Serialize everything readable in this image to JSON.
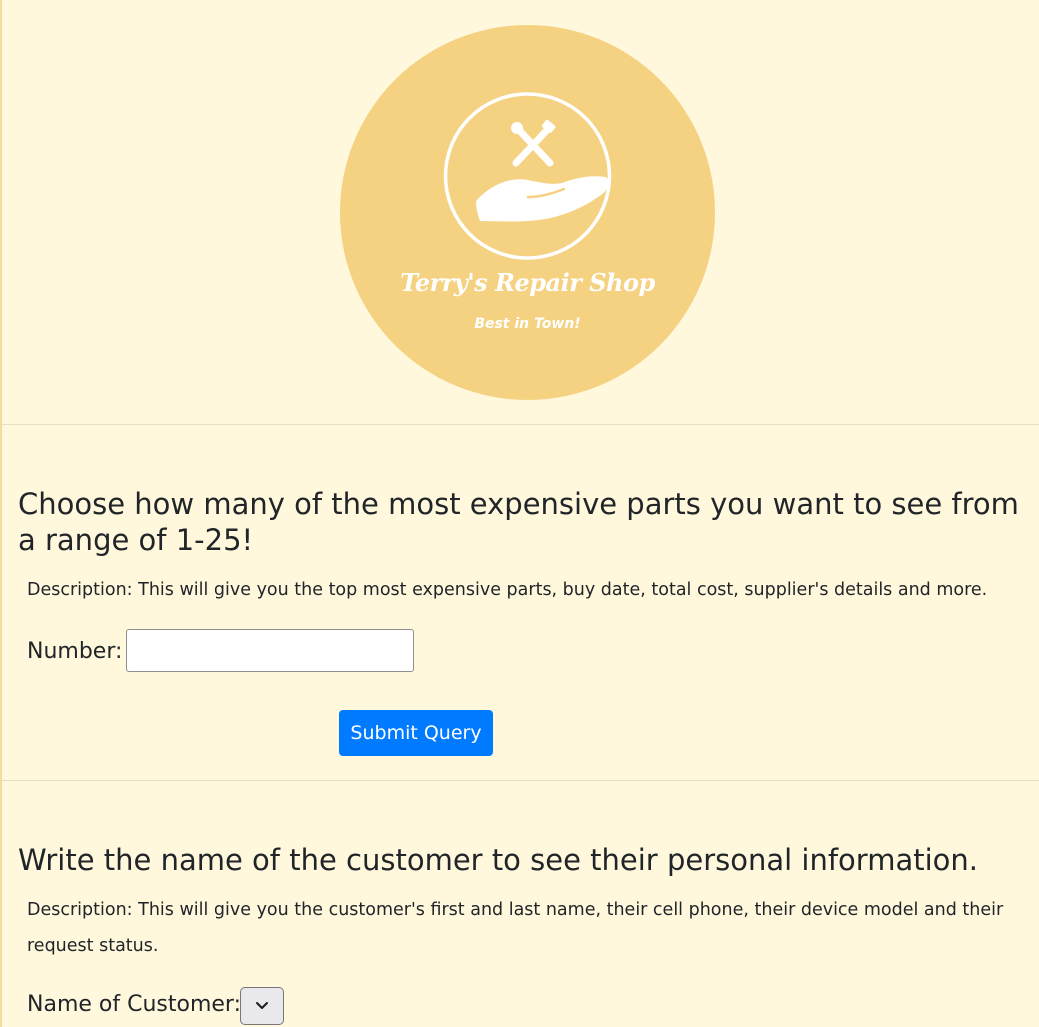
{
  "logo": {
    "name": "Terry's Repair Shop",
    "tagline": "Best in Town!",
    "icon": "hand-with-tools-icon",
    "colors": {
      "circle": "#f5d282",
      "foreground": "#ffffff"
    }
  },
  "sections": [
    {
      "heading": "Choose how many of the most expensive parts you want to see from a range of 1-25!",
      "description": "Description: This will give you the top most expensive parts, buy date, total cost, supplier's details and more.",
      "field_label": "Number:",
      "field_value": "",
      "submit_label": "Submit Query"
    },
    {
      "heading": "Write the name of the customer to see their personal information.",
      "description": "Description: This will give you the customer's first and last name, their cell phone, their device model and their request status.",
      "field_label": "Name of Customer:",
      "selected_value": ""
    }
  ],
  "colors": {
    "page_background": "#fff8dc",
    "button": "#007bff"
  }
}
